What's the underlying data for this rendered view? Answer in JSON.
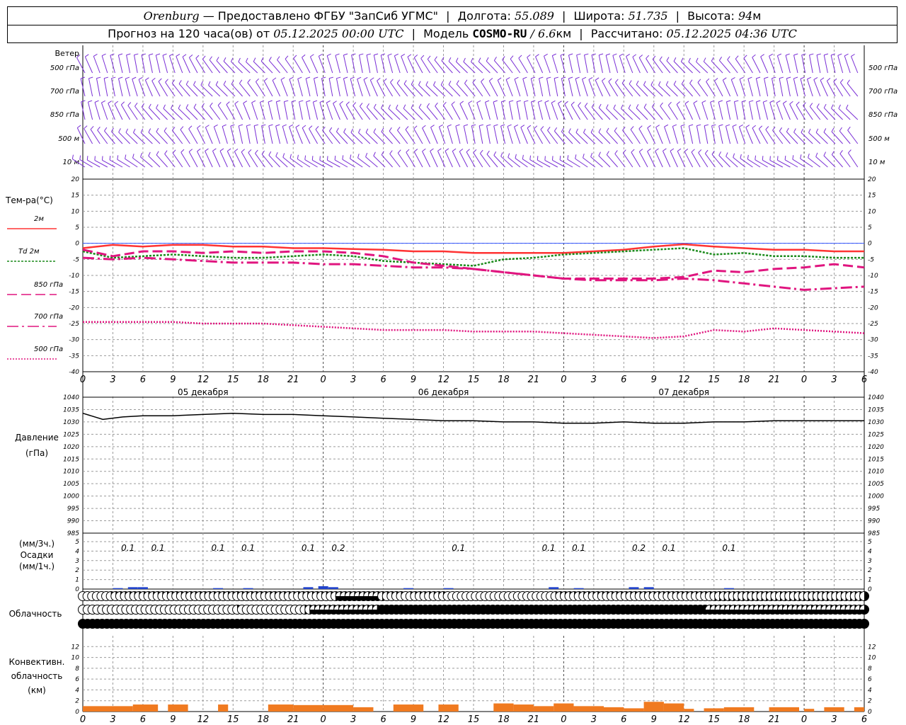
{
  "header": {
    "city": "Orenburg",
    "provider": "— Предоставлено ФГБУ \"ЗапСиб УГМС\"",
    "lon_label": "Долгота:",
    "lon_value": "55.089",
    "lat_label": "Широта:",
    "lat_value": "51.735",
    "alt_label": "Высота:",
    "alt_value": "94",
    "alt_unit": "м",
    "forecast_prefix": "Прогноз на 120 часа(ов) от",
    "forecast_start": "05.12.2025 00:00 UTC",
    "model_label": "Модель",
    "model_name": "COSMO-RU",
    "model_res": "/ 6.6",
    "model_res_unit": "км",
    "calc_label": "Рассчитано:",
    "calc_time": "05.12.2025 04:36 UTC"
  },
  "time_axis": {
    "hour_labels": [
      "0",
      "3",
      "6",
      "9",
      "12",
      "15",
      "18",
      "21",
      "0",
      "3",
      "6",
      "9",
      "12",
      "15",
      "18",
      "21",
      "0",
      "3",
      "6",
      "9",
      "12",
      "15",
      "18",
      "21",
      "0",
      "3",
      "6"
    ],
    "days": [
      "05 декабря",
      "06 декабря",
      "07 декабря"
    ]
  },
  "wind": {
    "title": "Ветер",
    "levels": [
      "500 гПа",
      "700 гПа",
      "850 гПа",
      "500 м",
      "10 м"
    ]
  },
  "chart_data": [
    {
      "type": "line",
      "name": "temperature",
      "title_lines": [
        "Тем-ра(°С)"
      ],
      "ylim": [
        -40,
        20
      ],
      "yticks": [
        20,
        15,
        10,
        5,
        0,
        -5,
        -10,
        -15,
        -20,
        -25,
        -30,
        -35,
        -40
      ],
      "x_hours": [
        0,
        3,
        6,
        9,
        12,
        15,
        18,
        21,
        24,
        27,
        30,
        33,
        36,
        39,
        42,
        45,
        48,
        51,
        54,
        57,
        60,
        63,
        66,
        69,
        72,
        75,
        78
      ],
      "series": [
        {
          "name": "2м",
          "color": "#ff3333",
          "dash": "solid",
          "values": [
            -1.5,
            -0.5,
            -1.0,
            -0.5,
            -0.5,
            -1.0,
            -1.0,
            -1.5,
            -1.5,
            -1.8,
            -2.0,
            -2.5,
            -2.5,
            -3.0,
            -3.0,
            -3.0,
            -3.0,
            -2.5,
            -2.0,
            -1.0,
            -0.3,
            -1.0,
            -1.5,
            -2.0,
            -2.0,
            -2.5,
            -2.5
          ]
        },
        {
          "name": "Td 2м",
          "color": "#1a8a1a",
          "dash": "dot",
          "values": [
            -2.5,
            -4.5,
            -4.0,
            -3.5,
            -4.0,
            -4.5,
            -4.5,
            -4.0,
            -3.5,
            -4.0,
            -5.5,
            -6.0,
            -6.5,
            -7.0,
            -5.0,
            -4.5,
            -3.5,
            -3.0,
            -2.5,
            -2.0,
            -1.5,
            -3.5,
            -3.0,
            -4.0,
            -4.0,
            -4.5,
            -4.5
          ]
        },
        {
          "name": "850 гПа",
          "color": "#e0157f",
          "dash": "long",
          "values": [
            -2.0,
            -4.0,
            -2.5,
            -2.5,
            -3.0,
            -2.5,
            -3.0,
            -2.5,
            -2.5,
            -3.0,
            -4.0,
            -6.0,
            -7.0,
            -8.0,
            -9.0,
            -10.0,
            -11.0,
            -11.0,
            -11.0,
            -11.0,
            -10.5,
            -8.5,
            -9.0,
            -8.0,
            -7.5,
            -6.5,
            -7.5
          ]
        },
        {
          "name": "700 гПа",
          "color": "#e0157f",
          "dash": "dashdot",
          "values": [
            -4.5,
            -5.0,
            -4.5,
            -5.0,
            -5.5,
            -6.0,
            -6.0,
            -6.0,
            -6.5,
            -6.5,
            -7.0,
            -7.5,
            -7.5,
            -8.0,
            -9.0,
            -10.0,
            -11.0,
            -11.5,
            -11.5,
            -11.5,
            -11.0,
            -11.5,
            -12.5,
            -13.5,
            -14.5,
            -14.0,
            -13.5
          ]
        },
        {
          "name": "500 гПа",
          "color": "#e0157f",
          "dash": "shortdot",
          "values": [
            -24.5,
            -24.5,
            -24.5,
            -24.5,
            -25.0,
            -25.0,
            -25.0,
            -25.5,
            -26.0,
            -26.5,
            -27.0,
            -27.0,
            -27.0,
            -27.5,
            -27.5,
            -27.5,
            -28.0,
            -28.5,
            -29.0,
            -29.5,
            -29.0,
            -27.0,
            -27.5,
            -26.5,
            -27.0,
            -27.5,
            -28.0
          ]
        }
      ]
    },
    {
      "type": "line",
      "name": "pressure",
      "title_lines": [
        "Давление",
        "(гПа)"
      ],
      "ylim": [
        985,
        1040
      ],
      "yticks": [
        1040,
        1035,
        1030,
        1025,
        1020,
        1015,
        1010,
        1005,
        1000,
        995,
        990,
        985
      ],
      "x_hours": [
        0,
        2,
        4,
        6,
        9,
        12,
        15,
        18,
        21,
        24,
        27,
        30,
        33,
        36,
        39,
        42,
        45,
        48,
        51,
        54,
        57,
        60,
        63,
        66,
        69,
        72,
        75,
        78
      ],
      "series": [
        {
          "name": "pressure",
          "color": "#000000",
          "values": [
            1033.5,
            1031.0,
            1032.0,
            1032.5,
            1032.5,
            1033.0,
            1033.5,
            1033.0,
            1033.0,
            1032.5,
            1032.0,
            1031.5,
            1031.0,
            1030.5,
            1030.5,
            1030.0,
            1030.0,
            1029.5,
            1029.5,
            1030.0,
            1029.5,
            1029.5,
            1030.0,
            1030.0,
            1030.5,
            1030.5,
            1030.5,
            1030.5
          ]
        }
      ]
    },
    {
      "type": "bar",
      "name": "precipitation",
      "title_lines": [
        "(мм/3ч.)",
        "Осадки",
        "(мм/1ч.)"
      ],
      "ylim": [
        0,
        5
      ],
      "yticks": [
        5,
        4,
        3,
        2,
        1,
        0
      ],
      "labels": [
        {
          "hour": 4.5,
          "text": "0.1"
        },
        {
          "hour": 7.5,
          "text": "0.1"
        },
        {
          "hour": 13.5,
          "text": "0.1"
        },
        {
          "hour": 16.5,
          "text": "0.1"
        },
        {
          "hour": 22.5,
          "text": "0.1"
        },
        {
          "hour": 25.5,
          "text": "0.2"
        },
        {
          "hour": 37.5,
          "text": "0.1"
        },
        {
          "hour": 46.5,
          "text": "0.1"
        },
        {
          "hour": 49.5,
          "text": "0.1"
        },
        {
          "hour": 55.5,
          "text": "0.2"
        },
        {
          "hour": 58.5,
          "text": "0.1"
        },
        {
          "hour": 64.5,
          "text": "0.1"
        }
      ],
      "bars": [
        {
          "hour": 3.5,
          "value": 0.1
        },
        {
          "hour": 5.0,
          "value": 0.2
        },
        {
          "hour": 6.0,
          "value": 0.2
        },
        {
          "hour": 13.5,
          "value": 0.1
        },
        {
          "hour": 16.5,
          "value": 0.1
        },
        {
          "hour": 22.5,
          "value": 0.2
        },
        {
          "hour": 24.0,
          "value": 0.3
        },
        {
          "hour": 25.0,
          "value": 0.2
        },
        {
          "hour": 32.5,
          "value": 0.1
        },
        {
          "hour": 36.5,
          "value": 0.1
        },
        {
          "hour": 47.0,
          "value": 0.2
        },
        {
          "hour": 49.5,
          "value": 0.1
        },
        {
          "hour": 55.0,
          "value": 0.2
        },
        {
          "hour": 56.5,
          "value": 0.2
        },
        {
          "hour": 64.5,
          "value": 0.1
        }
      ]
    },
    {
      "type": "table",
      "name": "cloudiness",
      "title_lines": [
        "Облачность"
      ],
      "rows": [
        {
          "level": "upper",
          "oktas": [
            0,
            0,
            0,
            0,
            0,
            0,
            1,
            3,
            2,
            2,
            2,
            2,
            2,
            2,
            1,
            1,
            1,
            2,
            2,
            2,
            2,
            2,
            1,
            1,
            2,
            2,
            2,
            2,
            2,
            2,
            2,
            2,
            2,
            2,
            2,
            2,
            2,
            2,
            2,
            1,
            2,
            2,
            2,
            2,
            2,
            2,
            2,
            2,
            2,
            2,
            2,
            2,
            2,
            2,
            4,
            6,
            6,
            6,
            6,
            6,
            6,
            6,
            6,
            6,
            4,
            2,
            2,
            2,
            2,
            0,
            1,
            1,
            2,
            2,
            2,
            2,
            2,
            2,
            0,
            0,
            0,
            0,
            0,
            0,
            0,
            0,
            0,
            0,
            0,
            0,
            0,
            0,
            0,
            0,
            0,
            0,
            0,
            0,
            0,
            0,
            0,
            2,
            2,
            2,
            1,
            2,
            1,
            1,
            2,
            2,
            2,
            2,
            2,
            2,
            2,
            2,
            2,
            2,
            2,
            2,
            2,
            2,
            2,
            2,
            1,
            2,
            2,
            1,
            2,
            2,
            2,
            2,
            2,
            2,
            1,
            4,
            4,
            4,
            4,
            4,
            4,
            4,
            4,
            4,
            4,
            4,
            4,
            4,
            4,
            4,
            4,
            4,
            4,
            4,
            4,
            4,
            4,
            4,
            4,
            4,
            4,
            4,
            4,
            4,
            4,
            4,
            4,
            4
          ]
        },
        {
          "level": "middle",
          "oktas": [
            0,
            0,
            0,
            0,
            0,
            0,
            0,
            0,
            0,
            0,
            0,
            0,
            0,
            0,
            0,
            0,
            0,
            0,
            0,
            0,
            0,
            0,
            0,
            0,
            0,
            0,
            0,
            0,
            0,
            0,
            0,
            0,
            2,
            0,
            0,
            0,
            0,
            0,
            0,
            0,
            0,
            0,
            0,
            0,
            0,
            0,
            4,
            4,
            6,
            6,
            6,
            6,
            6,
            6,
            6,
            6,
            6,
            6,
            6,
            6,
            6,
            6,
            8,
            8,
            8,
            8,
            8,
            8,
            8,
            8,
            8,
            8,
            8,
            8,
            8,
            8,
            8,
            8,
            8,
            8,
            8,
            8,
            8,
            8,
            8,
            8,
            8,
            8,
            8,
            8,
            8,
            8,
            8,
            8,
            8,
            8,
            8,
            8,
            8,
            8,
            8,
            8,
            8,
            8,
            8,
            8,
            8,
            8,
            8,
            8,
            8,
            8,
            8,
            8,
            8,
            8,
            8,
            8,
            8,
            8,
            8,
            8,
            8,
            8,
            8,
            8,
            8,
            8,
            8,
            8,
            6,
            6,
            6,
            6,
            6,
            6,
            6,
            6,
            6,
            6,
            6,
            6,
            6,
            6,
            6,
            6,
            6,
            6,
            6,
            6,
            6,
            6,
            6,
            6,
            6,
            6,
            6,
            6,
            6,
            6,
            6,
            6,
            6
          ]
        },
        {
          "level": "lower",
          "oktas": [
            8,
            8,
            8,
            8,
            8,
            8,
            8,
            8,
            8,
            8,
            8,
            8,
            8,
            8,
            8,
            8,
            8,
            8,
            8,
            8,
            8,
            8,
            8,
            8,
            8,
            8,
            8,
            8,
            8,
            8,
            8,
            8,
            8,
            8,
            8,
            8,
            8,
            8,
            8,
            8,
            8,
            8,
            8,
            8,
            8,
            8,
            8,
            8,
            8,
            8,
            8,
            8,
            8,
            8,
            8,
            8,
            8,
            8,
            8,
            8,
            8,
            8,
            8,
            8,
            8,
            8,
            8,
            8,
            8,
            8,
            8,
            8,
            8,
            8,
            8,
            8,
            8,
            8,
            8,
            8,
            8,
            8,
            8,
            8,
            8,
            8,
            8,
            8,
            8,
            8,
            8,
            8,
            8,
            8,
            8,
            8,
            8,
            8,
            8,
            8,
            8,
            8,
            8,
            8,
            8,
            8,
            8,
            8,
            8,
            8,
            8,
            8,
            8,
            8,
            8,
            8,
            8,
            8,
            8,
            8,
            8,
            8,
            8,
            8,
            8,
            8,
            8,
            8,
            8,
            8,
            8,
            8,
            8,
            8,
            8,
            8,
            8,
            8,
            8,
            8,
            8,
            8,
            8,
            8,
            8,
            8,
            8,
            8,
            8,
            8,
            8,
            8,
            8,
            8,
            8,
            8,
            8,
            8,
            8,
            8,
            8,
            8,
            8
          ]
        }
      ]
    },
    {
      "type": "bar",
      "name": "convective_cloud",
      "title_lines": [
        "Конвективн.",
        "облачность",
        "(км)"
      ],
      "ylim": [
        0,
        14
      ],
      "yticks": [
        12,
        10,
        8,
        6,
        4,
        2,
        0
      ],
      "bars": [
        {
          "from": 0,
          "to": 5,
          "value": 1.0
        },
        {
          "from": 5,
          "to": 7.5,
          "value": 1.3
        },
        {
          "from": 8.5,
          "to": 10.5,
          "value": 1.3
        },
        {
          "from": 13.5,
          "to": 14.5,
          "value": 1.3
        },
        {
          "from": 18.5,
          "to": 21,
          "value": 1.3
        },
        {
          "from": 21,
          "to": 24,
          "value": 1.2
        },
        {
          "from": 24,
          "to": 27,
          "value": 1.2
        },
        {
          "from": 27,
          "to": 29,
          "value": 0.8
        },
        {
          "from": 31,
          "to": 34,
          "value": 1.3
        },
        {
          "from": 35.5,
          "to": 37.5,
          "value": 1.3
        },
        {
          "from": 41,
          "to": 43,
          "value": 1.5
        },
        {
          "from": 43,
          "to": 45,
          "value": 1.3
        },
        {
          "from": 45,
          "to": 47,
          "value": 1.0
        },
        {
          "from": 47,
          "to": 49,
          "value": 1.5
        },
        {
          "from": 49,
          "to": 52,
          "value": 1.0
        },
        {
          "from": 52,
          "to": 54,
          "value": 0.8
        },
        {
          "from": 54,
          "to": 56,
          "value": 0.6
        },
        {
          "from": 56,
          "to": 58,
          "value": 1.8
        },
        {
          "from": 58,
          "to": 60,
          "value": 1.5
        },
        {
          "from": 60,
          "to": 61,
          "value": 0.5
        },
        {
          "from": 62,
          "to": 64,
          "value": 0.6
        },
        {
          "from": 64,
          "to": 67,
          "value": 0.8
        },
        {
          "from": 68.5,
          "to": 71.5,
          "value": 0.8
        },
        {
          "from": 72,
          "to": 73,
          "value": 0.5
        },
        {
          "from": 74,
          "to": 76,
          "value": 0.8
        },
        {
          "from": 77,
          "to": 78,
          "value": 0.8
        }
      ]
    }
  ],
  "colors": {
    "wind": "#7a2fd6",
    "grid": "#9a9a9a",
    "precip": "#2244cc",
    "convective": "#f07a20"
  }
}
